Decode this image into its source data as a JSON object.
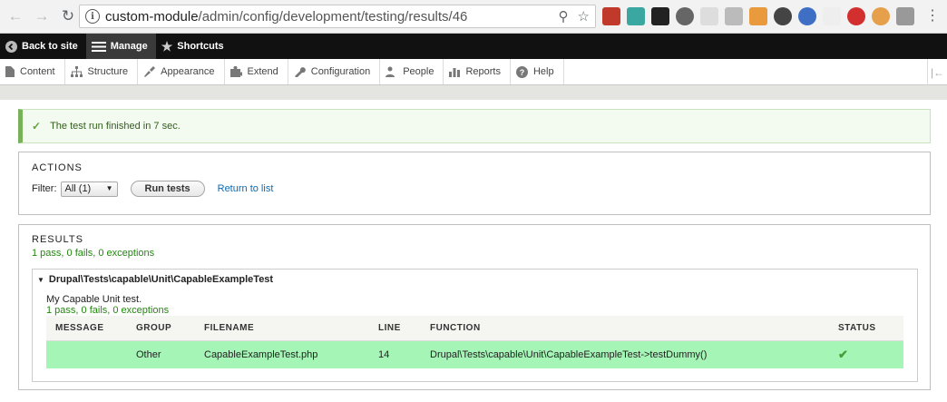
{
  "browser": {
    "url_host": "custom-module",
    "url_path": "/admin/config/development/testing/results/46"
  },
  "toolbar": {
    "back_to_site": "Back to site",
    "manage": "Manage",
    "shortcuts": "Shortcuts"
  },
  "tray": {
    "items": [
      "Content",
      "Structure",
      "Appearance",
      "Extend",
      "Configuration",
      "People",
      "Reports",
      "Help"
    ]
  },
  "message": {
    "text": "The test run finished in 7 sec."
  },
  "actions": {
    "legend": "ACTIONS",
    "filter_label": "Filter:",
    "filter_value": "All (1)",
    "run_button": "Run tests",
    "return_link": "Return to list"
  },
  "results": {
    "legend": "RESULTS",
    "summary": "1 pass, 0 fails, 0 exceptions",
    "test": {
      "title": "Drupal\\Tests\\capable\\Unit\\CapableExampleTest",
      "description": "My Capable Unit test.",
      "summary": "1 pass, 0 fails, 0 exceptions",
      "columns": [
        "MESSAGE",
        "GROUP",
        "FILENAME",
        "LINE",
        "FUNCTION",
        "STATUS"
      ],
      "rows": [
        {
          "message": "",
          "group": "Other",
          "filename": "CapableExampleTest.php",
          "line": "14",
          "function": "Drupal\\Tests\\capable\\Unit\\CapableExampleTest->testDummy()",
          "status_icon": "checkmark-icon"
        }
      ]
    }
  },
  "colors": {
    "pass_row": "#a5f5b6",
    "pass_text": "#22870e",
    "message_border": "#77b259",
    "link": "#0b6ab0"
  }
}
